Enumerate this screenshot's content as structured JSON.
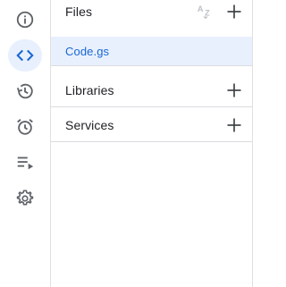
{
  "sidebar": {
    "items": [
      {
        "name": "overview",
        "icon": "info-icon",
        "active": false
      },
      {
        "name": "editor",
        "icon": "code-icon",
        "active": true
      },
      {
        "name": "project-history",
        "icon": "history-icon",
        "active": false
      },
      {
        "name": "triggers",
        "icon": "alarm-icon",
        "active": false
      },
      {
        "name": "executions",
        "icon": "playlist-play-icon",
        "active": false
      },
      {
        "name": "project-settings",
        "icon": "gear-icon",
        "active": false
      }
    ]
  },
  "files_panel": {
    "files_header": "Files",
    "sort_icon": "sort-az-icon",
    "files": [
      "Code.gs"
    ],
    "libraries_label": "Libraries",
    "services_label": "Services",
    "add_icon": "add-icon"
  },
  "colors": {
    "active_bg": "#e8f0fe",
    "active_text": "#1967d2",
    "icon": "#5f6368",
    "divider": "#dadce0"
  }
}
